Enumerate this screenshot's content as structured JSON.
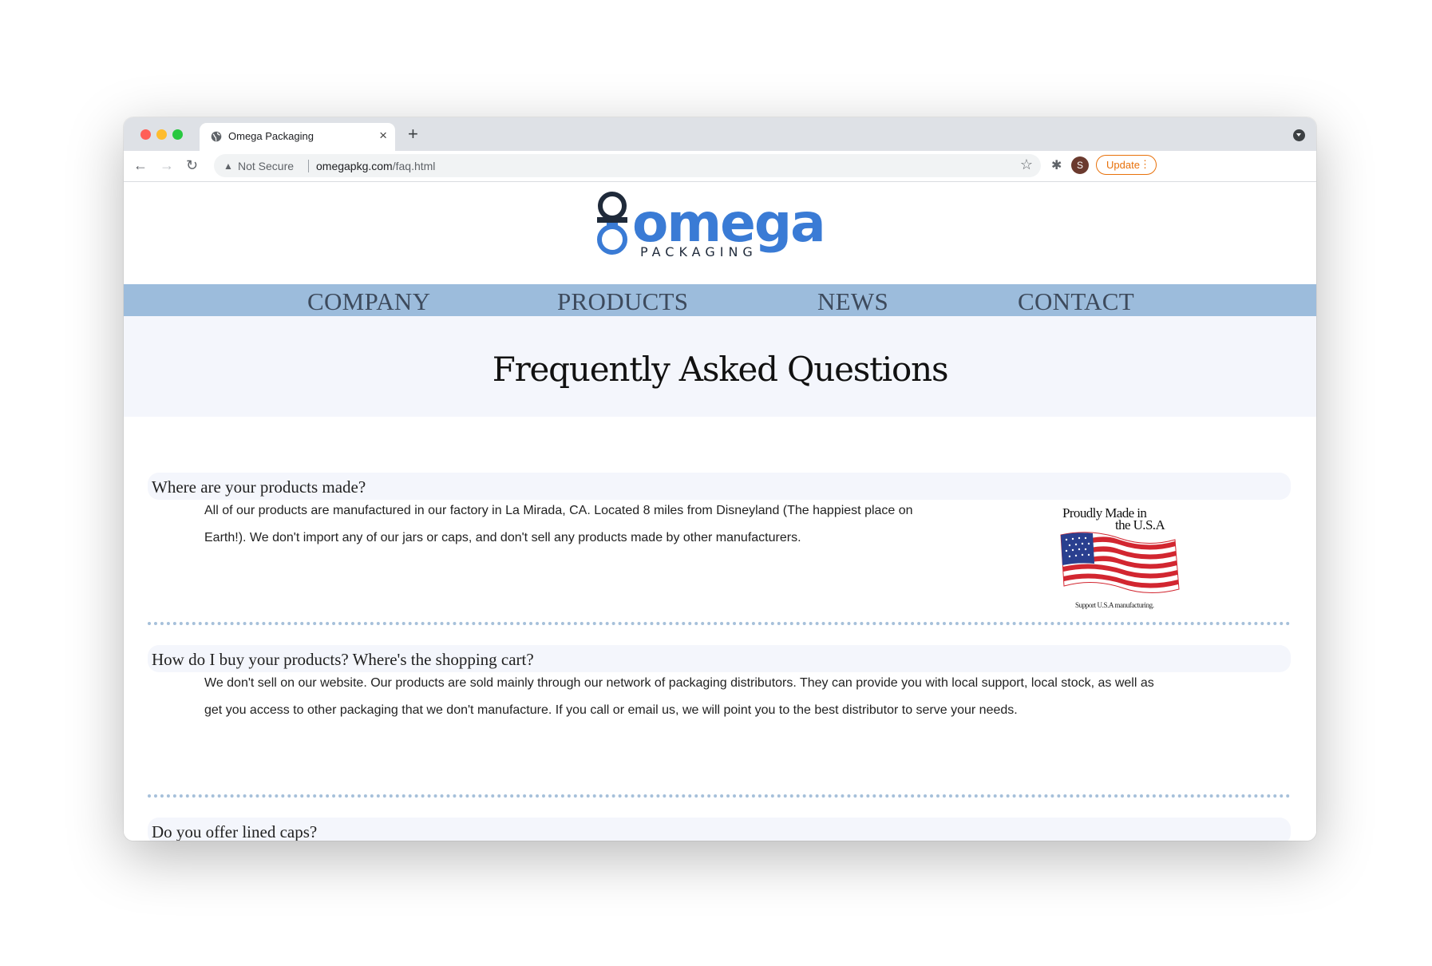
{
  "browser": {
    "tab_title": "Omega Packaging",
    "tab_close": "×",
    "new_tab": "+",
    "security_label": "Not Secure",
    "url_host": "omegapkg.com",
    "url_path": "/faq.html",
    "profile_initial": "S",
    "update_label": "Update"
  },
  "logo": {
    "wordmark": "omega",
    "tagline": "PACKAGING",
    "colors": {
      "blue": "#3a7bd5",
      "dark": "#1f2a3a"
    }
  },
  "nav": {
    "items": [
      {
        "label": "COMPANY"
      },
      {
        "label": "PRODUCTS"
      },
      {
        "label": "NEWS"
      },
      {
        "label": "CONTACT"
      }
    ],
    "bar_color": "#9cbcdc"
  },
  "hero": {
    "title": "Frequently Asked Questions"
  },
  "faq": [
    {
      "question": "Where are your products made?",
      "answer_lines": [
        "All of our products are manufactured in our factory in La Mirada, CA. Located 8 miles from Disneyland (The happiest place on",
        "Earth!). We don't import any of our jars or caps, and don't sell any products made by other manufacturers."
      ]
    },
    {
      "question": "How do I buy your products? Where's the shopping cart?",
      "answer_lines": [
        "We don't sell on our website. Our products are sold mainly through our network of packaging distributors. They can provide you with local support, local stock, as well as",
        "get you access to other packaging that we don't manufacture. If you call or email us, we will point you to the best distributor to serve your needs."
      ]
    },
    {
      "question": "Do you offer lined caps?"
    }
  ],
  "badge": {
    "line1": "Proudly Made in",
    "line2": "the U.S.A",
    "footer": "Support U.S.A manufacturing.",
    "flag_red": "#d22630",
    "flag_blue": "#2a3f8f"
  },
  "icons": {
    "tab_favicon": "globe-icon",
    "back": "arrow-left-icon",
    "forward": "arrow-right-icon",
    "reload": "reload-icon",
    "security": "warning-icon",
    "bookmark": "star-icon",
    "extensions": "puzzle-icon",
    "menu": "kebab-menu-icon",
    "tab_search": "tab-search-icon"
  }
}
